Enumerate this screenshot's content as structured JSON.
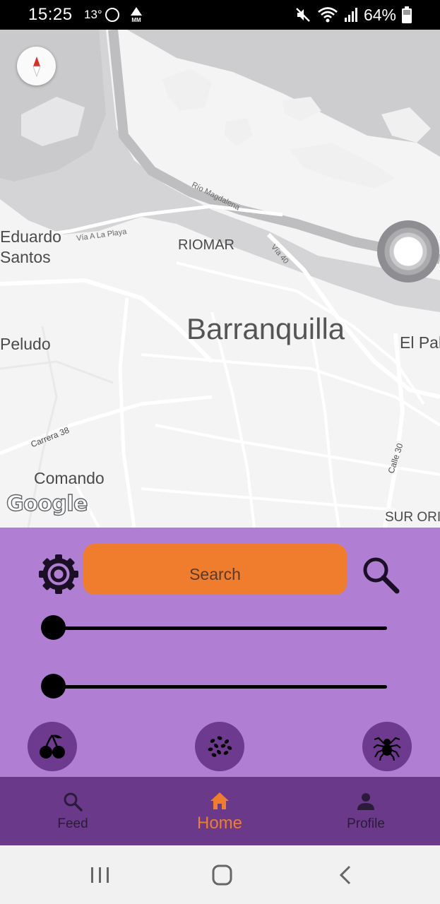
{
  "status_bar": {
    "time": "15:25",
    "temperature": "13°",
    "battery_percent": "64%"
  },
  "map": {
    "labels": {
      "eduardo_santos": "Eduardo\nSantos",
      "riomar": "RIOMAR",
      "barranquilla": "Barranquilla",
      "peludo": "Peludo",
      "el_pal": "El Pal",
      "comando": "Comando",
      "sur_ori": "SUR ORI",
      "via_a_la_playa": "Vía A La Playa",
      "rio_magdalena": "Río Magdalena",
      "via_40": "Vía 40",
      "carrera_38": "Carrera 38",
      "calle_30": "Calle 30"
    },
    "attribution": "Google"
  },
  "panel": {
    "search_label": "Search",
    "slider1_value": 0,
    "slider2_value": 0,
    "categories": [
      "cherry-icon",
      "seeds-icon",
      "spider-icon"
    ],
    "colors": {
      "panel_bg": "#b07ed2",
      "accent": "#f07d2d",
      "circle_bg": "#6d3a8f"
    }
  },
  "bottom_nav": {
    "items": [
      {
        "label": "Feed",
        "icon": "search-icon",
        "active": false
      },
      {
        "label": "Home",
        "icon": "home-icon",
        "active": true
      },
      {
        "label": "Profile",
        "icon": "person-icon",
        "active": false
      }
    ],
    "colors": {
      "bg": "#6a398a",
      "active": "#f07d2d"
    }
  }
}
